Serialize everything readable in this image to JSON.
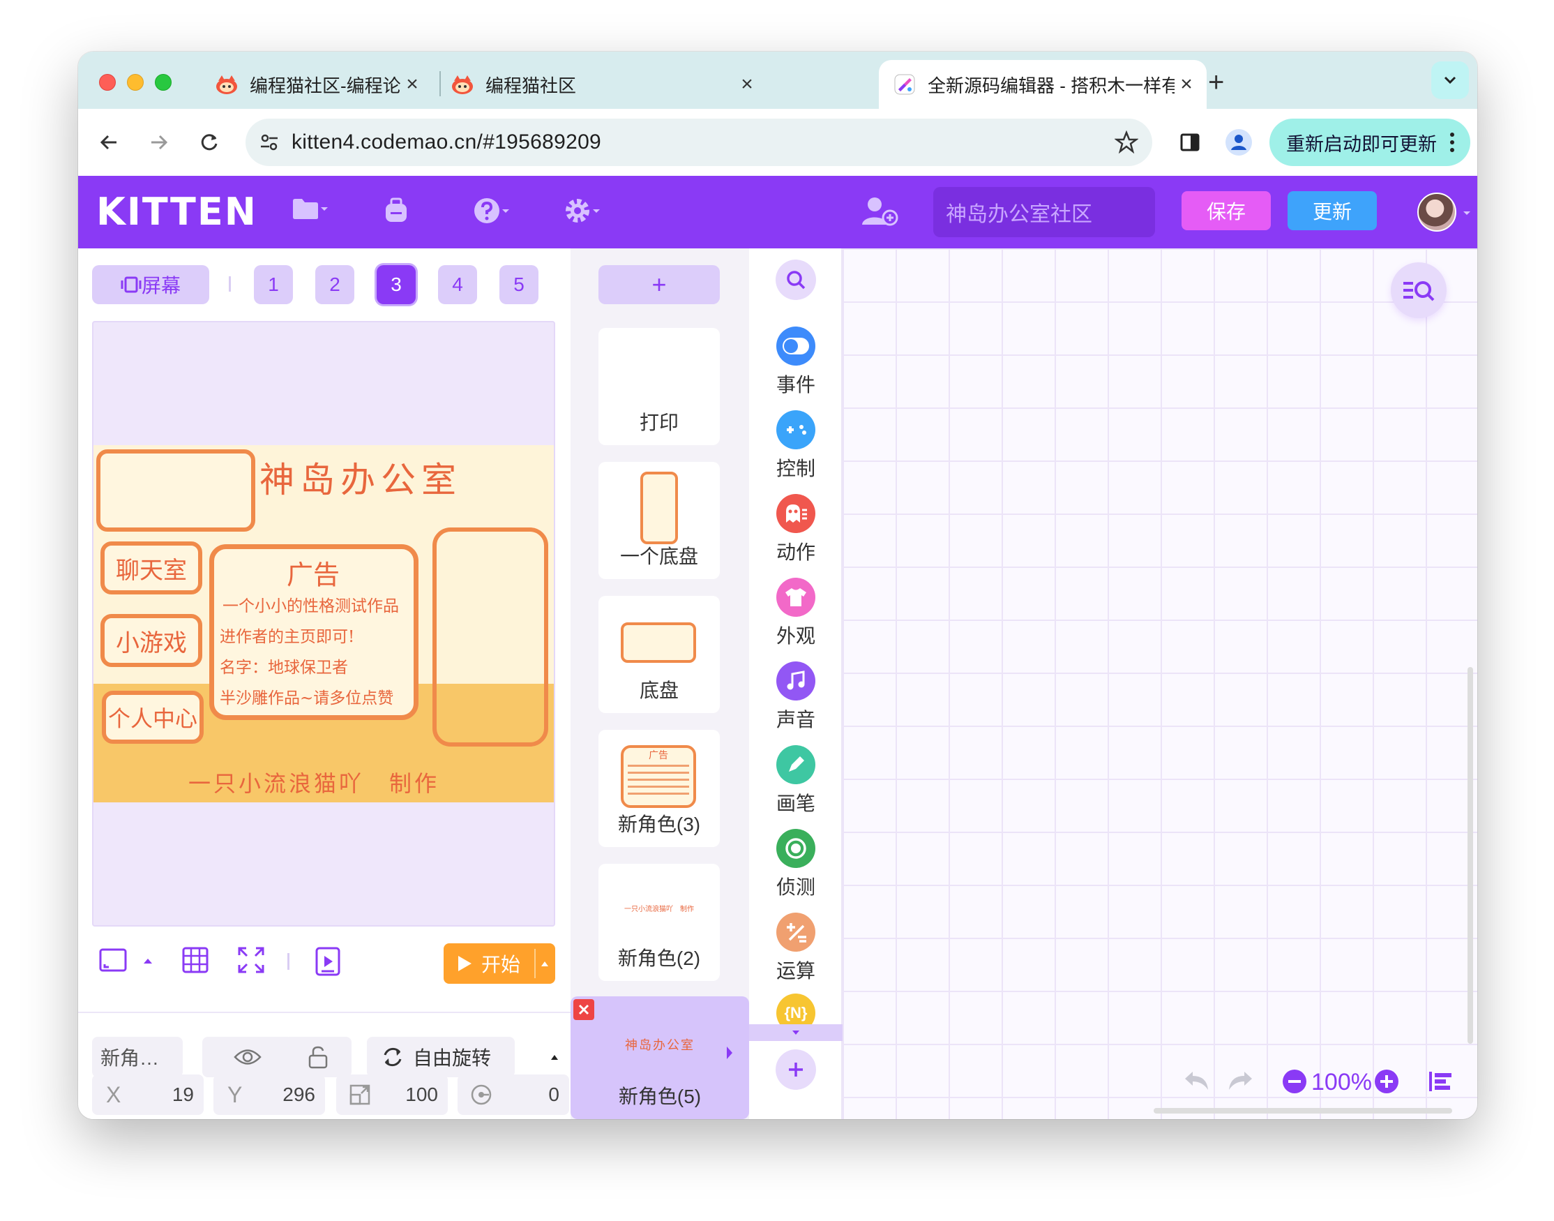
{
  "browser": {
    "tabs": [
      {
        "title": "编程猫社区-编程论坛广场-编程",
        "close": "×"
      },
      {
        "title": "编程猫社区",
        "close": "×"
      },
      {
        "title": "全新源码编辑器 - 搭积木一样有",
        "close": "×"
      }
    ],
    "new_tab": "+",
    "url": "kitten4.codemao.cn/#195689209",
    "update_label": "重新启动即可更新"
  },
  "app": {
    "logo": "KITTEN",
    "search_placeholder": "神岛办公室社区",
    "save_label": "保存",
    "update_label": "更新"
  },
  "stage_panel": {
    "screen_label": "屏幕",
    "pages": [
      "1",
      "2",
      "3",
      "4",
      "5"
    ],
    "current_page": "3",
    "scene": {
      "title": "神岛办公室",
      "buttons": [
        "聊天室",
        "小游戏",
        "个人中心"
      ],
      "ad_title": "广告",
      "ad_lines": [
        "一个小小的性格测试作品",
        "进作者的主页即可!",
        "名字：地球保卫者",
        "半沙雕作品~请多位点赞"
      ],
      "credit": "一只小流浪猫吖　制作"
    },
    "start_label": "开始"
  },
  "properties": {
    "name": "新角…",
    "rotation_mode": "自由旋转",
    "x_label": "X",
    "x": "19",
    "y_label": "Y",
    "y": "296",
    "size": "100",
    "direction": "0"
  },
  "sprites": {
    "add": "+",
    "items": [
      {
        "label": "打印"
      },
      {
        "label": "一个底盘"
      },
      {
        "label": "底盘"
      },
      {
        "label": "新角色(3)",
        "thumb_title": "广告"
      },
      {
        "label": "新角色(2)",
        "thumb_text": "一只小流浪猫吖　制作"
      },
      {
        "label": "新角色(5)",
        "thumb_text": "神岛办公室"
      }
    ]
  },
  "categories": [
    {
      "label": "事件",
      "color": "#3d8bfb"
    },
    {
      "label": "控制",
      "color": "#3aa4fa"
    },
    {
      "label": "动作",
      "color": "#f0574e"
    },
    {
      "label": "外观",
      "color": "#f269c8"
    },
    {
      "label": "声音",
      "color": "#9257f4"
    },
    {
      "label": "画笔",
      "color": "#3ec7a2"
    },
    {
      "label": "侦测",
      "color": "#3aaf5b"
    },
    {
      "label": "运算",
      "color": "#f0a070"
    },
    {
      "label": "{N}",
      "color": "#f7c531"
    }
  ],
  "workspace": {
    "zoom": "100%"
  }
}
